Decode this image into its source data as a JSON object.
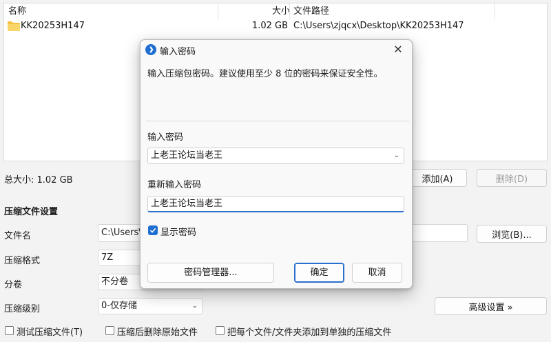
{
  "file_list": {
    "columns": {
      "name": "名称",
      "size": "大小",
      "path": "文件路径"
    },
    "rows": [
      {
        "name": "KK20253H147",
        "size": "1.02 GB",
        "path": "C:\\Users\\zjqcx\\Desktop\\KK20253H147",
        "icon": "folder-icon"
      }
    ]
  },
  "summary": {
    "total_size": "总大小: 1.02 GB"
  },
  "toolbar": {
    "add_label": "添加(A)",
    "delete_label": "删除(D)"
  },
  "compression": {
    "section_title": "压缩文件设置",
    "filename_label": "文件名",
    "filename_value": "C:\\Users\\",
    "browse_label": "浏览(B)...",
    "format_label": "压缩格式",
    "format_value": "7Z",
    "split_label": "分卷",
    "split_value": "不分卷",
    "level_label": "压缩级别",
    "level_value": "0-仅存储",
    "advanced_label": "高级设置 »"
  },
  "options": {
    "test_archive": "测试压缩文件(T)",
    "delete_after": "压缩后删除原始文件",
    "separate_archives": "把每个文件/文件夹添加到单独的压缩文件"
  },
  "dialog": {
    "title": "输入密码",
    "description": "输入压缩包密码。建议使用至少 8 位的密码来保证安全性。",
    "password_label": "输入密码",
    "password_value": "上老王论坛当老王",
    "confirm_label": "重新输入密码",
    "confirm_value": "上老王论坛当老王",
    "show_password_label": "显示密码",
    "show_password_checked": true,
    "manager_button": "密码管理器...",
    "ok_button": "确定",
    "cancel_button": "取消"
  },
  "colors": {
    "accent": "#1f6fd1",
    "folder": "#f5c244",
    "background": "#f3f3f3"
  }
}
